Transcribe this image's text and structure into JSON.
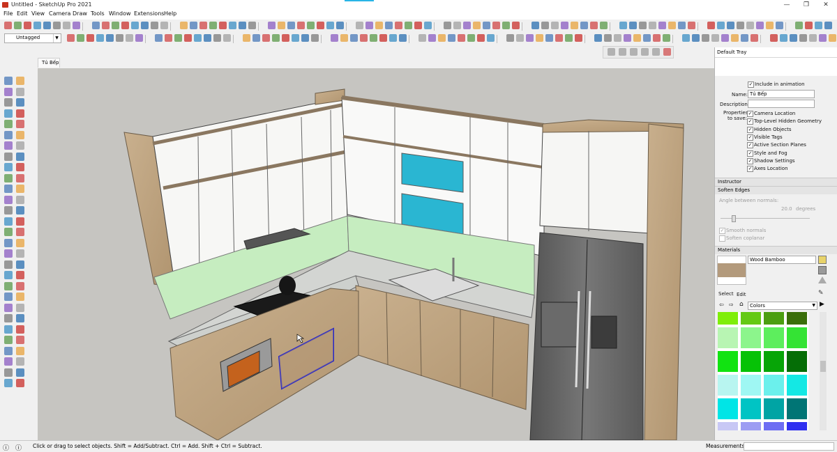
{
  "window": {
    "title": "Untitled - SketchUp Pro 2021",
    "minimize": "—",
    "maximize": "❐",
    "close": "✕"
  },
  "menu": [
    "File",
    "Edit",
    "View",
    "Camera",
    "Draw",
    "Tools",
    "Window",
    "Extensions",
    "Help"
  ],
  "toolbar": {
    "tag_dropdown": "Untagged"
  },
  "scene_tab": "Tủ Bếp",
  "tray": {
    "title": "Default Tray",
    "scenes": {
      "include_animation": "Include in animation",
      "name_label": "Name:",
      "name_value": "Tủ Bếp",
      "description_label": "Description:",
      "properties_label": "Properties to save:",
      "properties": [
        "Camera Location",
        "Top-Level Hidden Geometry",
        "Hidden Objects",
        "Visible Tags",
        "Active Section Planes",
        "Style and Fog",
        "Shadow Settings",
        "Axes Location"
      ]
    },
    "instructor": "Instructor",
    "soften_edges": {
      "title": "Soften Edges",
      "angle_label": "Angle between normals:",
      "angle_value": "20.0",
      "angle_unit": "degrees",
      "smooth": "Smooth normals",
      "coplanar": "Soften coplanar"
    },
    "materials": {
      "title": "Materials",
      "current": "Wood Bamboo",
      "tab_select": "Select",
      "tab_edit": "Edit",
      "library": "Colors",
      "colors": [
        "#7fee0a",
        "#64c914",
        "#4b9e11",
        "#3a6e0a",
        "#b8f5b3",
        "#8cf58c",
        "#5dee5d",
        "#34e334",
        "#11e311",
        "#06c206",
        "#07a507",
        "#056e06",
        "#b8f5f0",
        "#9ff7f3",
        "#6bf0ec",
        "#14e8e4",
        "#00e5e6",
        "#00c4c4",
        "#00a4a4",
        "#007575",
        "#c8c8f5",
        "#9d9df3",
        "#6d6df3",
        "#3030f0"
      ]
    }
  },
  "status": {
    "message": "Click or drag to select objects. Shift = Add/Subtract. Ctrl = Add. Shift + Ctrl = Subtract.",
    "measurements": "Measurements"
  }
}
